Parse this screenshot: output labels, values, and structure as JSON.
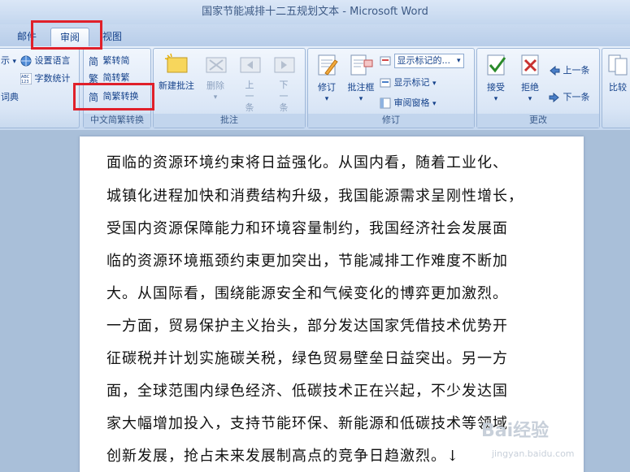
{
  "window": {
    "title": "国家节能减排十二五规划文本 - Microsoft Word"
  },
  "tabs": {
    "mail": "邮件",
    "review": "审阅",
    "view": "视图"
  },
  "proofing": {
    "set_language": "设置语言",
    "word_count": "字数统计",
    "dictionary": "词典",
    "left_cut": "示"
  },
  "chinese": {
    "to_traditional": "繁转简",
    "to_simplified": "简转繁",
    "convert": "简繁转换",
    "label": "中文简繁转换"
  },
  "comments": {
    "new": "新建批注",
    "delete": "删除",
    "prev": "上一条",
    "next": "下一条",
    "label": "批注"
  },
  "tracking": {
    "track": "修订",
    "balloons": "批注框",
    "display_markup": "显示标记的...",
    "show_markup": "显示标记",
    "reviewing_pane": "审阅窗格",
    "label": "修订"
  },
  "changes": {
    "accept": "接受",
    "reject": "拒绝",
    "prev": "上一条",
    "next": "下一条",
    "label": "更改"
  },
  "compare": {
    "label": "比较"
  },
  "document": {
    "lines": [
      "面临的资源环境约束将日益强化。从国内看，随着工业化、",
      "城镇化进程加快和消费结构升级，我国能源需求呈刚性增长，",
      "受国内资源保障能力和环境容量制约，我国经济社会发展面",
      "临的资源环境瓶颈约束更加突出，节能减排工作难度不断加",
      "大。从国际看，围绕能源安全和气候变化的博弈更加激烈。",
      "一方面，贸易保护主义抬头，部分发达国家凭借技术优势开",
      "征碳税并计划实施碳关税，绿色贸易壁垒日益突出。另一方",
      "面，全球范围内绿色经济、低碳技术正在兴起，不少发达国",
      "家大幅增加投入，支持节能环保、新能源和低碳技术等领域",
      "创新发展，抢占未来发展制高点的竞争日趋激烈。↓"
    ]
  },
  "watermark": {
    "text": "Bai经验",
    "site": "jingyan.baidu.com"
  }
}
